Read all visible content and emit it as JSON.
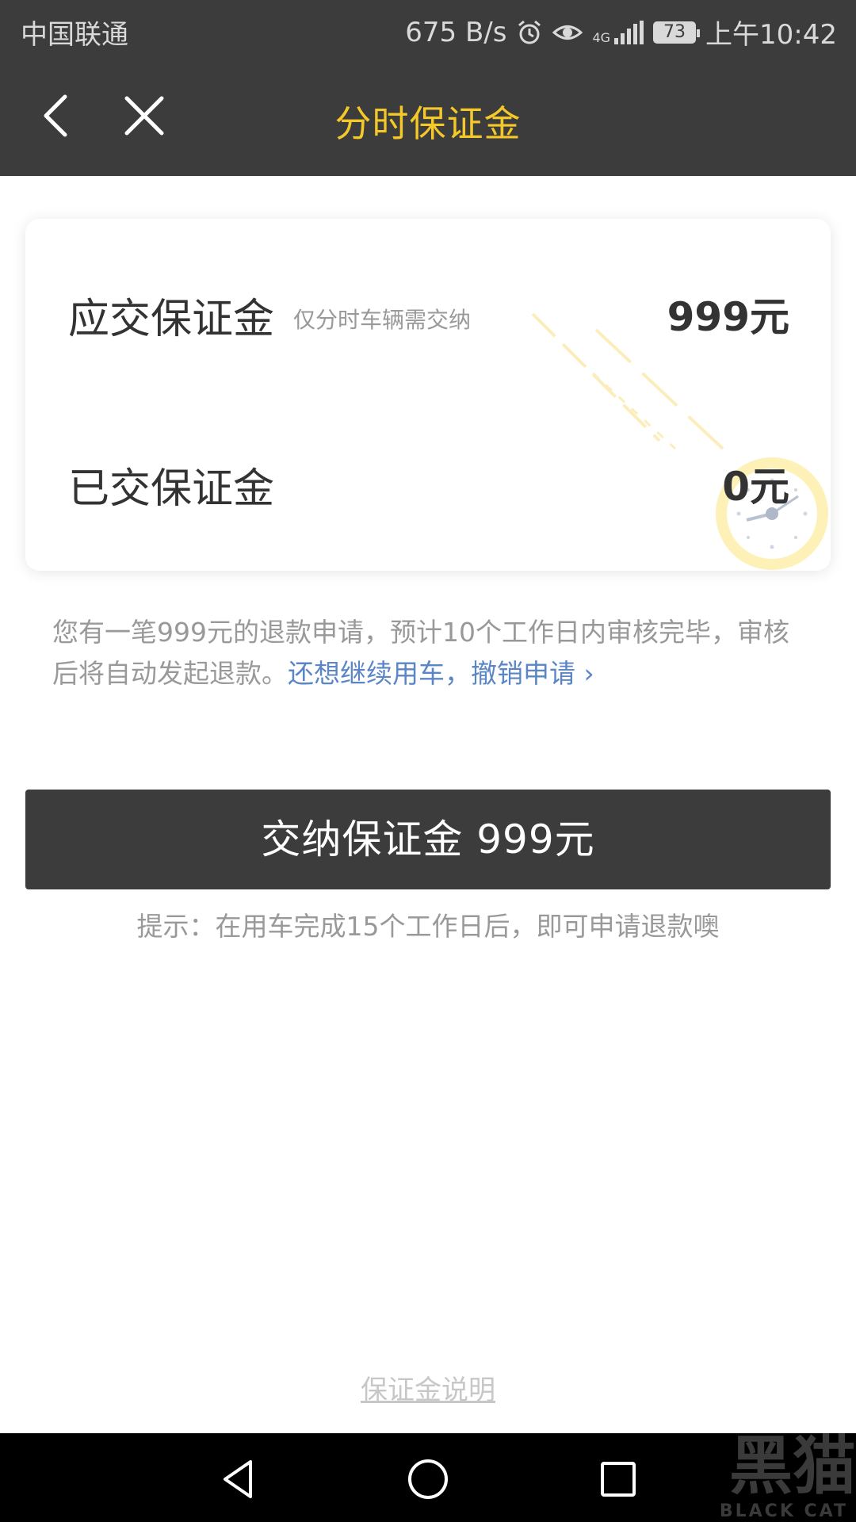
{
  "status_bar": {
    "carrier": "中国联通",
    "speed": "675 B/s",
    "network": "4G",
    "battery": "73",
    "time": "上午10:42"
  },
  "header": {
    "title": "分时保证金",
    "back_icon": "chevron-left-icon",
    "close_icon": "close-icon"
  },
  "card": {
    "due_label": "应交保证金",
    "due_note": "仅分时车辆需交纳",
    "due_value": "999元",
    "paid_label": "已交保证金",
    "paid_value": "0元"
  },
  "notice": {
    "text": "您有一笔999元的退款申请，预计10个工作日内审核完毕，审核后将自动发起退款。",
    "link": "还想继续用车，撤销申请 ›"
  },
  "pay_button": "交纳保证金 999元",
  "tip": "提示：在用车完成15个工作日后，即可申请退款噢",
  "explain_link": "保证金说明",
  "watermark": {
    "text": "黑猫",
    "sub": "BLACK CAT"
  },
  "colors": {
    "header_bg": "#3c3c3c",
    "title": "#f5c829",
    "link": "#5b86c6",
    "button_bg": "#3c3c3c"
  }
}
